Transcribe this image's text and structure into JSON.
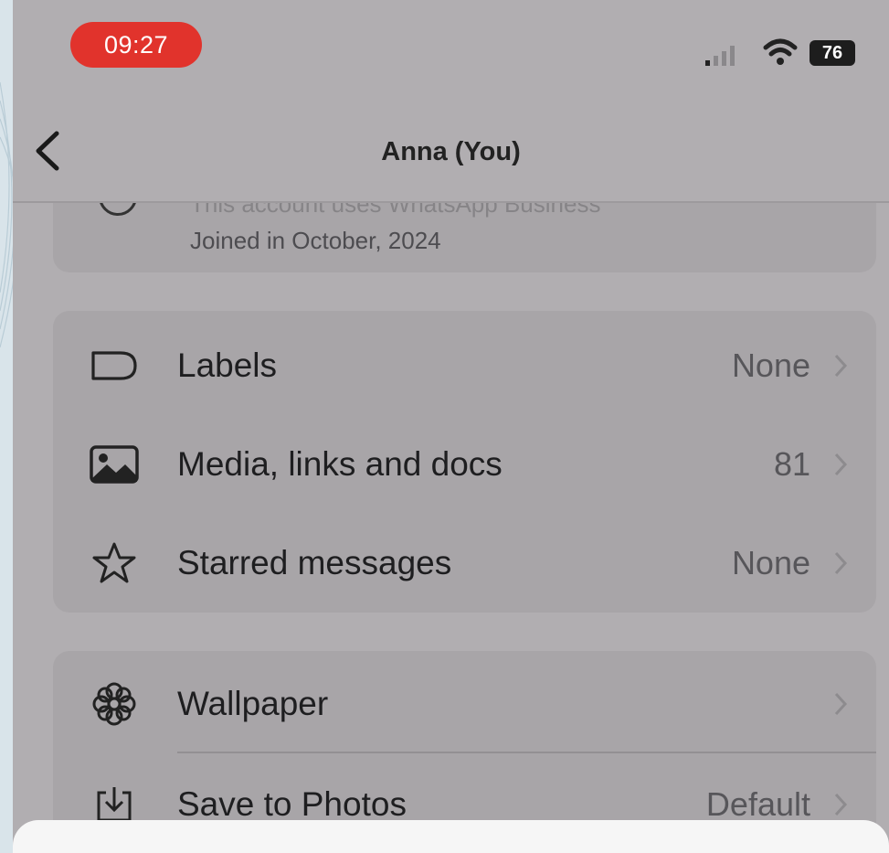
{
  "status_bar": {
    "time": "09:27",
    "battery": "76"
  },
  "nav": {
    "title": "Anna (You)"
  },
  "info": {
    "hidden_line": "This account uses WhatsApp Business",
    "joined": "Joined in October, 2024"
  },
  "section_1": [
    {
      "icon": "label-icon",
      "label": "Labels",
      "value": "None"
    },
    {
      "icon": "media-icon",
      "label": "Media, links and docs",
      "value": "81"
    },
    {
      "icon": "star-icon",
      "label": "Starred messages",
      "value": "None"
    }
  ],
  "section_2": [
    {
      "icon": "wallpaper-icon",
      "label": "Wallpaper",
      "value": ""
    },
    {
      "icon": "save-to-photos-icon",
      "label": "Save to Photos",
      "value": "Default"
    }
  ],
  "colors": {
    "time_pill": "#e1332c",
    "overlay": "#b1aeb1",
    "sheet": "#f6f6f6"
  }
}
